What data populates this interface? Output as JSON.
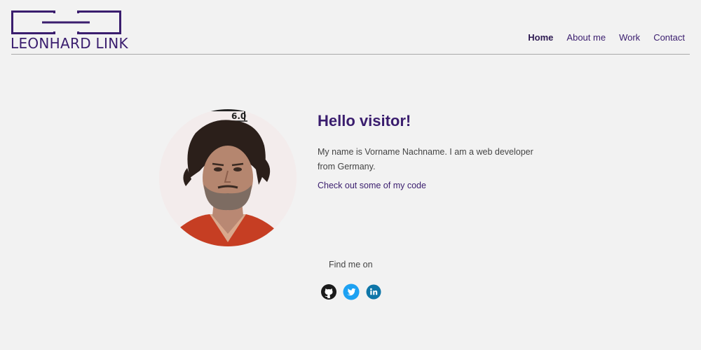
{
  "brand": {
    "name": "LEONHARD LINK",
    "color": "#3a1d6e"
  },
  "nav": {
    "items": [
      {
        "label": "Home",
        "active": true
      },
      {
        "label": "About me",
        "active": false
      },
      {
        "label": "Work",
        "active": false
      },
      {
        "label": "Contact",
        "active": false
      }
    ]
  },
  "hero": {
    "heading": "Hello visitor!",
    "intro": "My name is Vorname Nachname. I am a web developer from Germany.",
    "code_link": "Check out some of my code"
  },
  "profile_photo": {
    "sign_text": "6.0"
  },
  "social": {
    "label": "Find me on",
    "links": [
      {
        "icon": "github-icon",
        "color": "#1b1b1b"
      },
      {
        "icon": "twitter-icon",
        "color": "#1da1f2"
      },
      {
        "icon": "linkedin-icon",
        "color": "#0e76a8"
      }
    ]
  }
}
